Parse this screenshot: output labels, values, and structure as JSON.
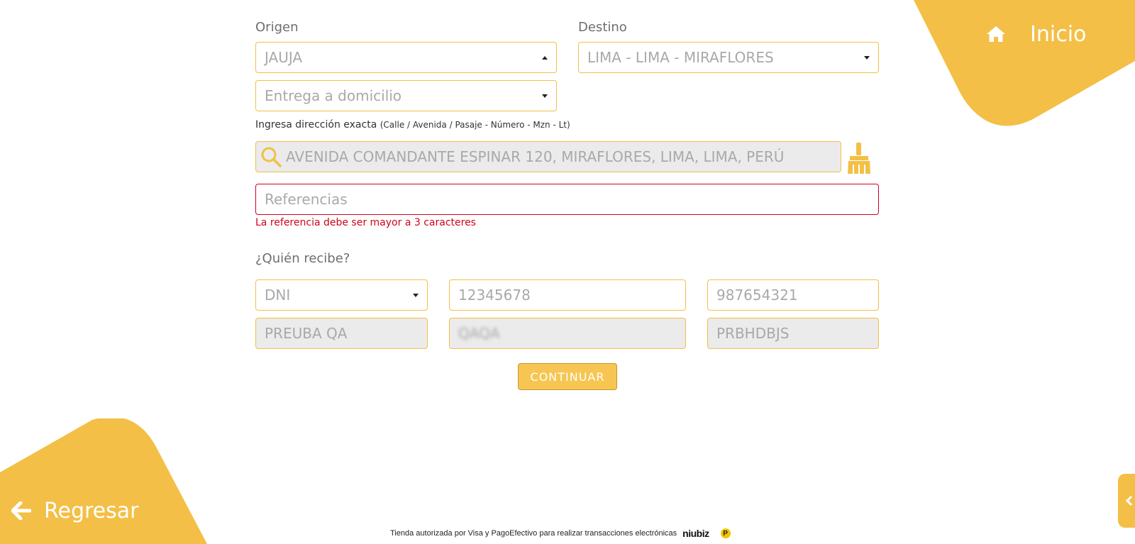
{
  "nav": {
    "home_label": "Inicio",
    "back_label": "Regresar"
  },
  "colors": {
    "accent": "#f3bf46",
    "error": "#d0021b"
  },
  "route": {
    "origin_label": "Origen",
    "origin_value": "JAUJA",
    "destination_label": "Destino",
    "destination_value": "LIMA - LIMA - MIRAFLORES",
    "delivery_value": "Entrega a domicilio"
  },
  "address": {
    "hint_main": "Ingresa dirección exacta",
    "hint_detail": "(Calle / Avenida / Pasaje - Número - Mzn - Lt)",
    "value": "AVENIDA COMANDANTE ESPINAR 120, MIRAFLORES, LIMA, LIMA, PERÚ",
    "references_placeholder": "Referencias",
    "references_error": "La referencia debe ser mayor a 3 caracteres"
  },
  "receiver": {
    "title": "¿Quién recibe?",
    "doc_type": "DNI",
    "doc_number": "12345678",
    "phone": "987654321",
    "first_name": "PREUBA QA",
    "middle_name": "QAQA",
    "last_name": "PRBHDBJS"
  },
  "actions": {
    "continue_label": "CONTINUAR"
  },
  "footer": {
    "text": "Tienda autorizada por Visa y PagoEfectivo para realizar transacciones electrónicas",
    "brand": "niubiz",
    "pe_mark": "P"
  }
}
